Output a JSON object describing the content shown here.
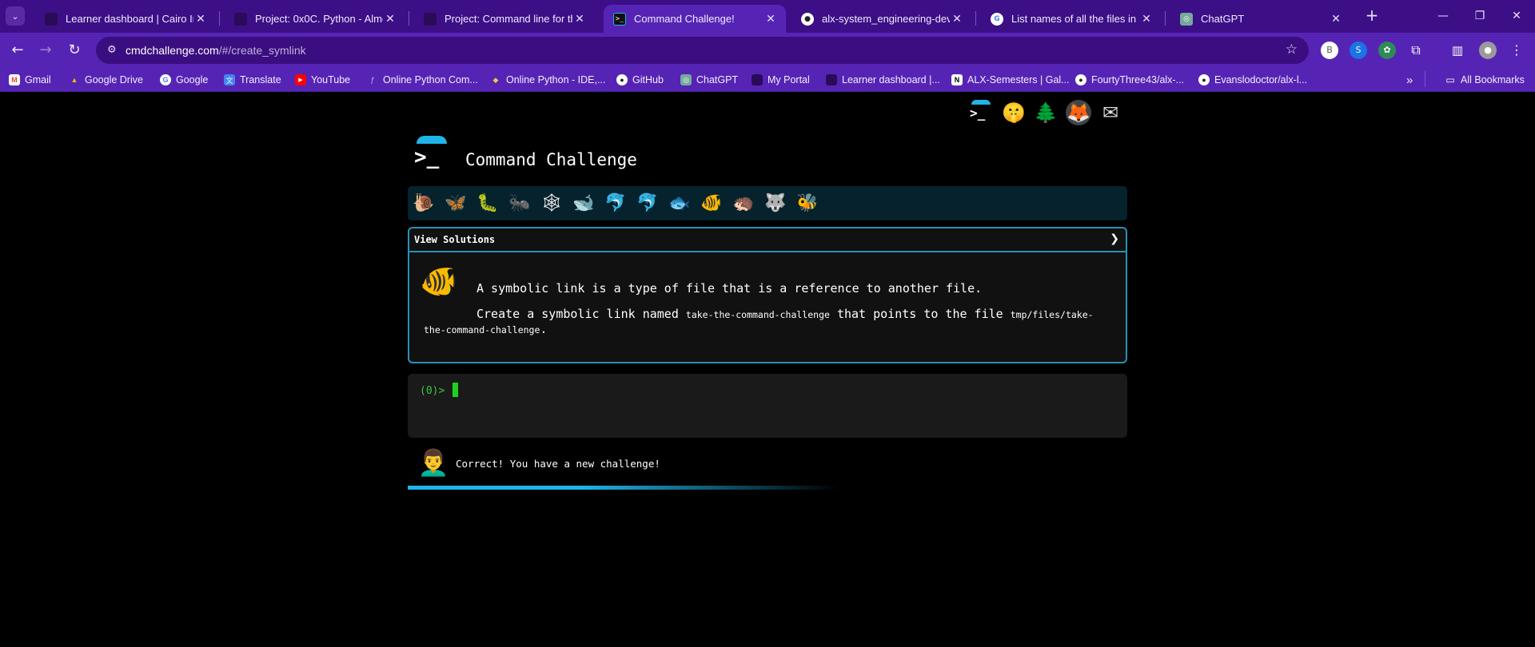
{
  "browser": {
    "tabs": [
      {
        "title": "Learner dashboard | Cairo Intra",
        "fav_color": "#2a0b57",
        "fav_glyph": ""
      },
      {
        "title": "Project: 0x0C. Python - Almost a",
        "fav_color": "#2a0b57",
        "fav_glyph": ""
      },
      {
        "title": "Project: Command line for the w",
        "fav_color": "#2a0b57",
        "fav_glyph": ""
      },
      {
        "title": "Command Challenge!",
        "fav_color": "#111111",
        "fav_glyph": ">_"
      },
      {
        "title": "alx-system_engineering-devops",
        "fav_color": "#ffffff",
        "fav_glyph": "●"
      },
      {
        "title": "List names of all the files in the",
        "fav_color": "#ffffff",
        "fav_glyph": "G"
      },
      {
        "title": "ChatGPT",
        "fav_color": "#74aa9c",
        "fav_glyph": "◎"
      }
    ],
    "window_buttons": {
      "minimize": "—",
      "restore": "❐",
      "close": "✕"
    },
    "new_tab": "+",
    "url_host": "cmdchallenge.com",
    "url_path": "/#/create_symlink",
    "profile_initial": "B",
    "bookmarks": [
      {
        "label": "Gmail",
        "icon": "gmail-icon",
        "color": "#ea4335",
        "glyph": "M"
      },
      {
        "label": "Google Drive",
        "icon": "drive-icon",
        "color": "#fbbc04",
        "glyph": "▲"
      },
      {
        "label": "Google",
        "icon": "google-icon",
        "color": "#ffffff",
        "glyph": "G"
      },
      {
        "label": "Translate",
        "icon": "translate-icon",
        "color": "#4285f4",
        "glyph": "文"
      },
      {
        "label": "YouTube",
        "icon": "youtube-icon",
        "color": "#ff0000",
        "glyph": "▶"
      },
      {
        "label": "Online Python Com...",
        "icon": "python-icon",
        "color": "#5624b5",
        "glyph": "ƒ"
      },
      {
        "label": "Online Python - IDE,...",
        "icon": "shield-icon",
        "color": "#3c8f3c",
        "glyph": "◆"
      },
      {
        "label": "GitHub",
        "icon": "github-icon",
        "color": "#ffffff",
        "glyph": "●"
      },
      {
        "label": "ChatGPT",
        "icon": "chatgpt-icon",
        "color": "#74aa9c",
        "glyph": "◎"
      },
      {
        "label": "My Portal",
        "icon": "portal-icon",
        "color": "#2a0b57",
        "glyph": ""
      },
      {
        "label": "Learner dashboard |...",
        "icon": "alx-icon",
        "color": "#2a0b57",
        "glyph": ""
      },
      {
        "label": "ALX-Semesters | Gal...",
        "icon": "notion-icon",
        "color": "#ffffff",
        "glyph": "N"
      },
      {
        "label": "FourtyThree43/alx-...",
        "icon": "github-icon",
        "color": "#ffffff",
        "glyph": "●"
      },
      {
        "label": "Evanslodoctor/alx-l...",
        "icon": "github-icon",
        "color": "#ffffff",
        "glyph": "●"
      }
    ],
    "overflow": "»",
    "all_bookmarks": "All Bookmarks"
  },
  "site": {
    "title": "Command Challenge",
    "logo_prompt": ">_",
    "social": [
      "🗨",
      "🤫",
      "🌲",
      "🦊",
      "✉"
    ],
    "levels": [
      "🐌",
      "🦋",
      "🐛",
      "🐜",
      "🕸",
      "🐋",
      "🐬",
      "🐬",
      "🐟",
      "🐠",
      "🦔",
      "🐺",
      "🐝"
    ],
    "challenge": {
      "header": "View Solutions",
      "chevron": "❯",
      "fish": "🐠",
      "line1": "A symbolic link is a type of file that is a reference to another file.",
      "line2_pre": "Create a symbolic link named ",
      "line2_code1": "take-the-command-challenge",
      "line2_mid": " that points to the file ",
      "line2_code2": "tmp/files/take-the-command-challenge",
      "line2_end": "."
    },
    "terminal": {
      "prompt": "(0)>"
    },
    "feedback": {
      "avatar": "👨‍🦱",
      "message": "Correct! You have a new challenge!"
    }
  }
}
